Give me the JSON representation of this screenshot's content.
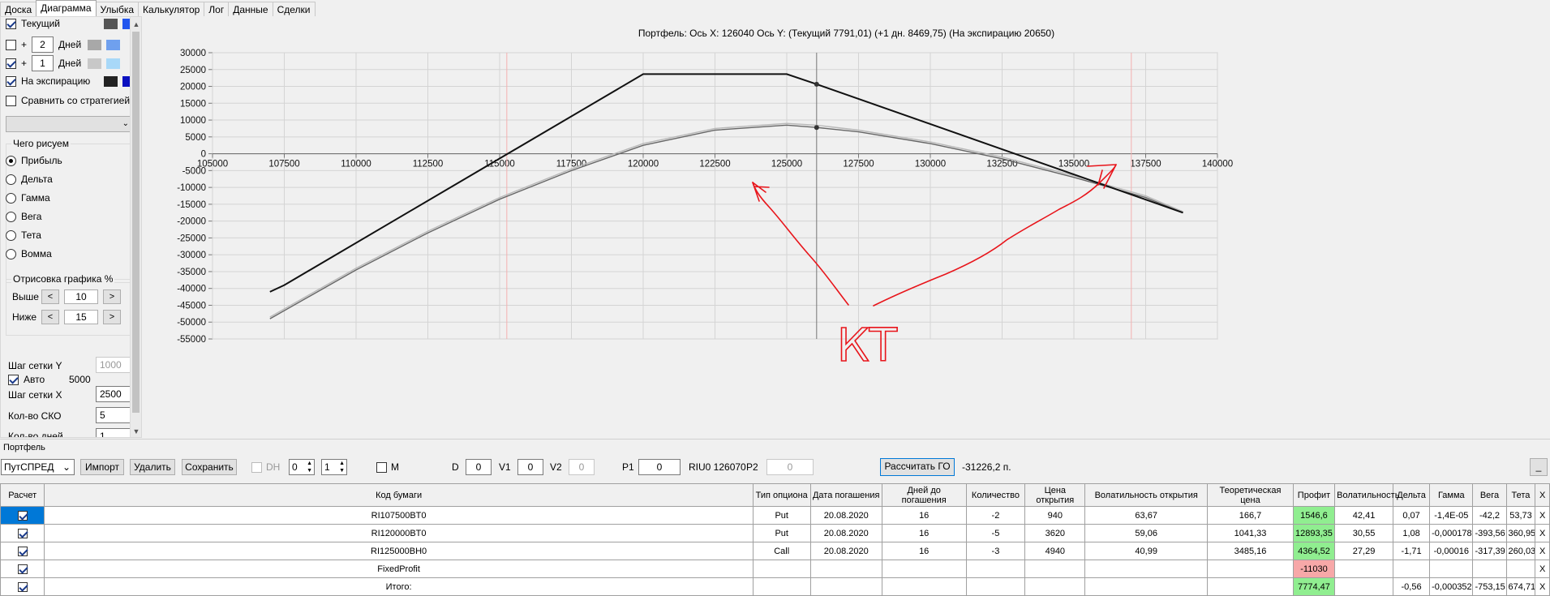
{
  "tabs": [
    "Доска",
    "Диаграмма",
    "Улыбка",
    "Калькулятор",
    "Лог",
    "Данные",
    "Сделки"
  ],
  "active_tab": 1,
  "left": {
    "current_label": "Текущий",
    "plus": "+",
    "days_label": "Дней",
    "days1": "2",
    "days2": "1",
    "expiry_label": "На экспирацию",
    "compare_label": "Сравнить со стратегией",
    "what_title": "Чего рисуем",
    "radio_options": [
      "Прибыль",
      "Дельта",
      "Гамма",
      "Вега",
      "Тета",
      "Вомма"
    ],
    "draw_title": "Отрисовка графика %",
    "above_label": "Выше",
    "above_value": "10",
    "below_label": "Ниже",
    "below_value": "15",
    "prev": "<",
    "next": ">",
    "grid_y_label": "Шаг сетки Y",
    "grid_y_value": "1000",
    "auto_label": "Авто",
    "auto_value": "5000",
    "grid_x_label": "Шаг сетки X",
    "grid_x_value": "2500",
    "sko_label": "Кол-во СКО",
    "sko_value": "5",
    "days_count_label": "Кол-во дней",
    "days_count_value": "1",
    "swatch_colors": [
      "#555555",
      "#2255ee",
      "#a8a8a8",
      "#6fa0ee",
      "#c8c8c8",
      "#a8d8f8",
      "#222222",
      "#0a10c0"
    ]
  },
  "chart_title": "Портфель: Ось X:  126040 Ось Y:  (Текущий 7791,01)  (+1 дн. 8469,75)  (На экспирацию 20650)",
  "annotation_text": "КТ",
  "chart_data": {
    "type": "line",
    "x_ticks": [
      105000,
      107500,
      110000,
      112500,
      115000,
      117500,
      120000,
      122500,
      125000,
      127500,
      130000,
      132500,
      135000,
      137500,
      140000
    ],
    "y_ticks": [
      30000,
      25000,
      20000,
      15000,
      10000,
      5000,
      0,
      -5000,
      -10000,
      -15000,
      -20000,
      -25000,
      -30000,
      -35000,
      -40000,
      -45000,
      -50000,
      -55000
    ],
    "xlim": [
      105000,
      140000
    ],
    "ylim": [
      -55000,
      30000
    ],
    "grid": true,
    "current_x": 126040,
    "sigma_lines_x": [
      115250,
      137000
    ],
    "series": [
      {
        "name": "На экспирацию",
        "color": "#111111",
        "points": [
          [
            107000,
            -41000
          ],
          [
            107500,
            -39000
          ],
          [
            120000,
            23650
          ],
          [
            125000,
            23650
          ],
          [
            126040,
            20650
          ],
          [
            138800,
            -17500
          ]
        ]
      },
      {
        "name": "Текущий",
        "color": "#666666",
        "points": [
          [
            107000,
            -49000
          ],
          [
            110000,
            -34500
          ],
          [
            112500,
            -23500
          ],
          [
            115000,
            -13500
          ],
          [
            117500,
            -5000
          ],
          [
            120000,
            2500
          ],
          [
            122500,
            7000
          ],
          [
            125000,
            8500
          ],
          [
            126040,
            7791
          ],
          [
            127500,
            6500
          ],
          [
            130000,
            3000
          ],
          [
            132500,
            -1500
          ],
          [
            135000,
            -7000
          ],
          [
            137500,
            -13000
          ],
          [
            138800,
            -17500
          ]
        ]
      },
      {
        "name": "+1 дн.",
        "color": "#b8b8b8",
        "points": [
          [
            107000,
            -48500
          ],
          [
            110000,
            -34000
          ],
          [
            112500,
            -23000
          ],
          [
            115000,
            -13000
          ],
          [
            117500,
            -4500
          ],
          [
            120000,
            3000
          ],
          [
            122500,
            7500
          ],
          [
            125000,
            9000
          ],
          [
            126040,
            8470
          ],
          [
            127500,
            7000
          ],
          [
            130000,
            3500
          ],
          [
            132500,
            -1000
          ],
          [
            135000,
            -6500
          ],
          [
            137500,
            -12500
          ],
          [
            138800,
            -17200
          ]
        ]
      }
    ]
  },
  "portfolio": {
    "title": "Портфель",
    "strategy": "ПутСПРЕД",
    "import": "Импорт",
    "delete": "Удалить",
    "save": "Сохранить",
    "dh": "DH",
    "spin1": "0",
    "spin2": "1",
    "m": "M",
    "d_label": "D",
    "d_value": "0",
    "v1_label": "V1",
    "v1_value": "0",
    "v2_label": "V2",
    "v2_value": "0",
    "p1_label": "P1",
    "p1_value": "0",
    "riu_label": "RIU0 126070",
    "p2_label": "P2",
    "p2_value": "0",
    "calc_go": "Рассчитать ГО",
    "go_value": "-31226,2 п.",
    "min_btn": "_"
  },
  "table": {
    "headers": [
      "Расчет",
      "Код бумаги",
      "Тип опциона",
      "Дата погашения",
      "Дней до погашения",
      "Количество",
      "Цена открытия",
      "Волатильность открытия",
      "Теоретическая цена",
      "Профит",
      "Волатильность",
      "Дельта",
      "Гамма",
      "Вега",
      "Тета",
      "X"
    ],
    "rows": [
      [
        "",
        "RI107500BT0",
        "Put",
        "20.08.2020",
        "16",
        "-2",
        "940",
        "63,67",
        "166,7",
        "1546,6",
        "42,41",
        "0,07",
        "-1,4E-05",
        "-42,2",
        "53,73",
        "X"
      ],
      [
        "",
        "RI120000BT0",
        "Put",
        "20.08.2020",
        "16",
        "-5",
        "3620",
        "59,06",
        "1041,33",
        "12893,35",
        "30,55",
        "1,08",
        "-0,000178",
        "-393,56",
        "360,95",
        "X"
      ],
      [
        "",
        "RI125000BH0",
        "Call",
        "20.08.2020",
        "16",
        "-3",
        "4940",
        "40,99",
        "3485,16",
        "4364,52",
        "27,29",
        "-1,71",
        "-0,00016",
        "-317,39",
        "260,03",
        "X"
      ],
      [
        "",
        "FixedProfit",
        "",
        "",
        "",
        "",
        "",
        "",
        "",
        "-11030",
        "",
        "",
        "",
        "",
        "",
        "X"
      ],
      [
        "",
        "Итого:",
        "",
        "",
        "",
        "",
        "",
        "",
        "",
        "7774,47",
        "",
        "-0,56",
        "-0,000352",
        "-753,15",
        "674,71",
        "X"
      ]
    ]
  }
}
